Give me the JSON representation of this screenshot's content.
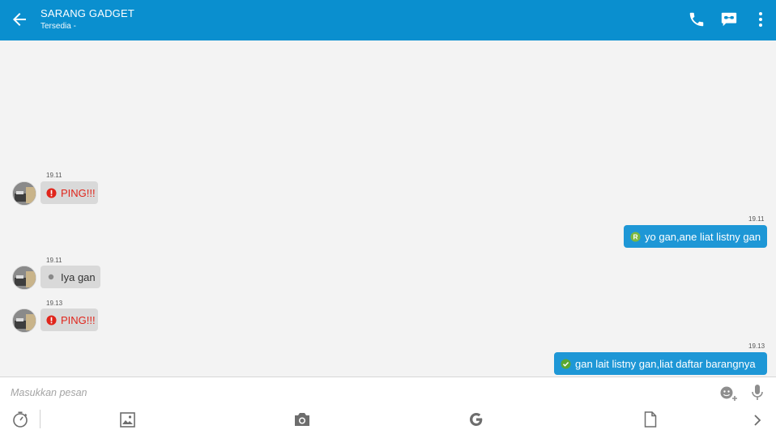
{
  "header": {
    "title": "SARANG GADGET",
    "subtitle": "Tersedia -",
    "icons": [
      "back-arrow-icon",
      "phone-icon",
      "bbm-video-icon",
      "more-vert-icon"
    ],
    "color": "#0a8fcf"
  },
  "messages": [
    {
      "direction": "incoming",
      "time": "19.11",
      "text": "PING!!!",
      "type": "ping",
      "icon": "alert-icon"
    },
    {
      "direction": "outgoing",
      "time": "19.11",
      "text": "yo gan,ane liat listny gan",
      "status": "read",
      "icon": "read-r-icon"
    },
    {
      "direction": "incoming",
      "time": "19.11",
      "text": "Iya gan",
      "type": "text",
      "icon": "dot-icon"
    },
    {
      "direction": "incoming",
      "time": "19.13",
      "text": "PING!!!",
      "type": "ping",
      "icon": "alert-icon"
    },
    {
      "direction": "outgoing",
      "time": "19.13",
      "text": "gan lait listny gan,liat daftar barangnya",
      "status": "delivered",
      "icon": "check-icon"
    }
  ],
  "composer": {
    "placeholder": "Masukkan pesan",
    "toolbar": [
      "timer-icon",
      "image-icon",
      "camera-icon",
      "google-icon",
      "file-icon",
      "chevron-right-icon"
    ],
    "right_icons": [
      "emoji-add-icon",
      "mic-icon"
    ]
  },
  "colors": {
    "ping": "#e0251b",
    "outgoing_bubble": "#1e97d6",
    "incoming_bubble": "#d9d9d9"
  }
}
